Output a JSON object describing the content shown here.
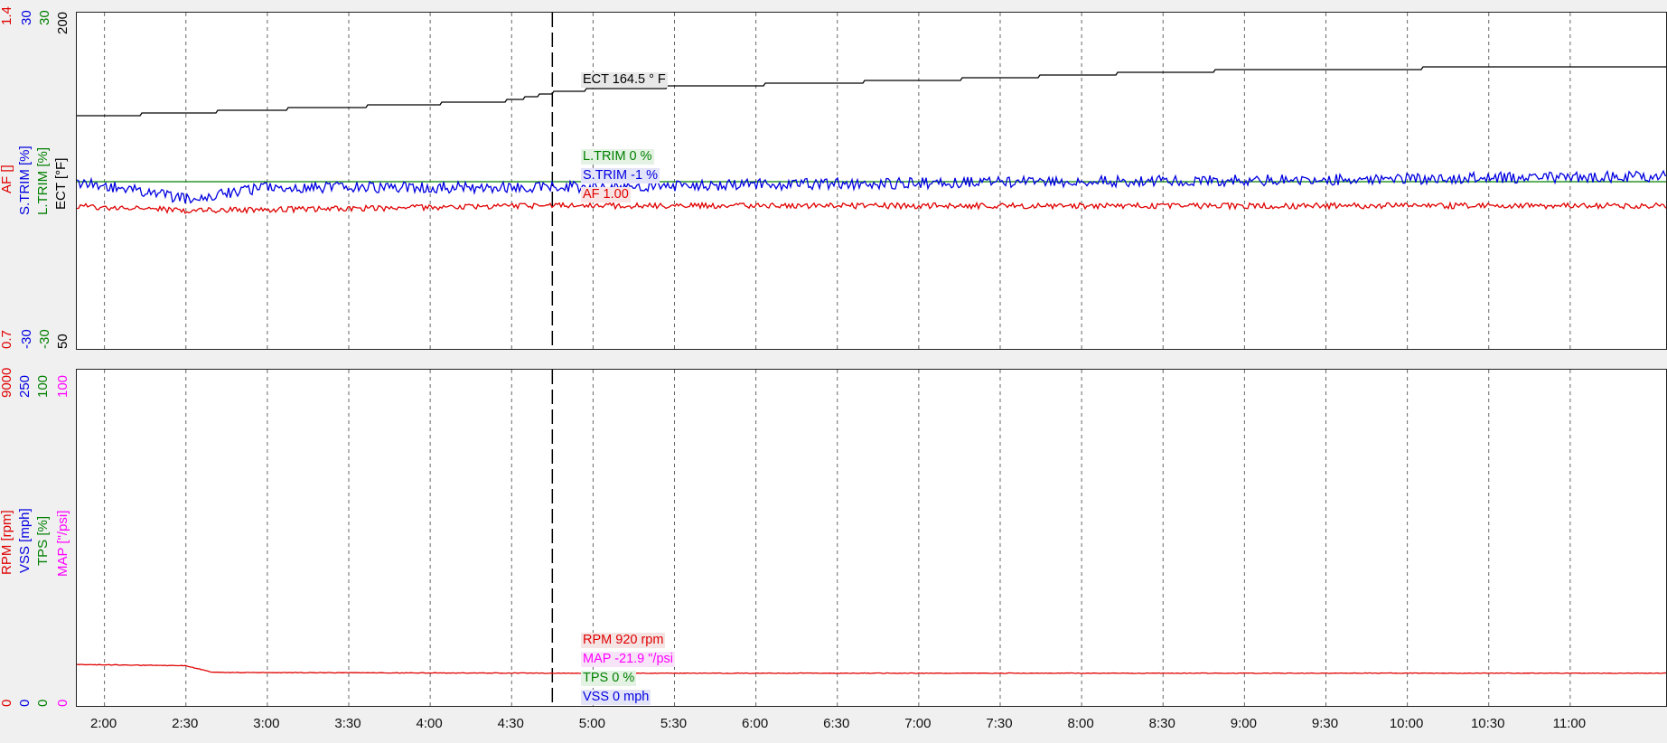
{
  "colors": {
    "af": "#e00000",
    "strim": "#0000e0",
    "ltrim": "#008000",
    "ect": "#000000",
    "map": "#ff00ff",
    "rpm": "#e00000",
    "vss": "#0000e0",
    "tps": "#008000"
  },
  "top_axis": {
    "af_max": "1.4",
    "af_min": "0.7",
    "strim_max": "30",
    "strim_min": "-30",
    "ect_max": "200",
    "ect_min": "50",
    "af_label": "AF []",
    "strim_label": "S.TRIM [%]",
    "ltrim_label": "L.TRIM [%]",
    "ect_label": "ECT [°F]"
  },
  "bottom_axis": {
    "rpm_max": "9000",
    "rpm_min": "0",
    "vss_max": "250",
    "vss_min": "0",
    "tps_max": "100",
    "tps_min": "0",
    "map_max": "100",
    "map_min": "0",
    "rpm_label": "RPM [rpm]",
    "vss_label": "VSS [mph]",
    "tps_label": "TPS [%]",
    "map_label": "MAP [\"/psi]"
  },
  "cursor": {
    "ect": "ECT 164.5 ° F",
    "ltrim": "L.TRIM 0 %",
    "strim": "S.TRIM -1 %",
    "af": "AF 1.00",
    "rpm": "RPM 920 rpm",
    "map": "MAP -21.9 \"/psi",
    "tps": "TPS 0 %",
    "vss": "VSS 0 mph"
  },
  "x_ticks": [
    "2:00",
    "2:30",
    "3:00",
    "3:30",
    "4:00",
    "4:30",
    "5:00",
    "5:30",
    "6:00",
    "6:30",
    "7:00",
    "7:30",
    "8:00",
    "8:30",
    "9:00",
    "9:30",
    "10:00",
    "10:30",
    "11:00"
  ],
  "chart_data": {
    "type": "line",
    "x_range_minutes": [
      1.83,
      11.6
    ],
    "cursor_time": "4:45",
    "top_series": [
      {
        "name": "ECT",
        "unit": "°F",
        "ylim": [
          50,
          200
        ],
        "x": [
          "1:50",
          "2:30",
          "3:00",
          "3:30",
          "4:00",
          "4:30",
          "4:45",
          "5:00",
          "5:30",
          "6:00",
          "6:30",
          "7:00",
          "7:30",
          "8:00",
          "8:30",
          "9:00",
          "9:30",
          "10:00",
          "10:30",
          "11:00",
          "11:35"
        ],
        "values": [
          154,
          155.5,
          157,
          158.2,
          159.5,
          161,
          164.5,
          166,
          167,
          168,
          169,
          170,
          171,
          172.5,
          173.5,
          174.5,
          175,
          175.3,
          175.5,
          175.8,
          176.3
        ]
      },
      {
        "name": "L.TRIM",
        "unit": "%",
        "ylim": [
          -30,
          30
        ],
        "x": [
          "1:50",
          "11:35"
        ],
        "values": [
          0,
          0
        ]
      },
      {
        "name": "S.TRIM",
        "unit": "%",
        "ylim": [
          -30,
          30
        ],
        "x": [
          "1:50",
          "2:30",
          "3:00",
          "4:00",
          "4:45",
          "6:00",
          "8:00",
          "10:00",
          "11:35"
        ],
        "values": [
          0,
          -3,
          -1,
          -1,
          -1,
          -0.5,
          0,
          0.5,
          1
        ]
      },
      {
        "name": "AF",
        "unit": "",
        "ylim": [
          0.7,
          1.4
        ],
        "x": [
          "1:50",
          "2:30",
          "4:45",
          "11:35"
        ],
        "values": [
          1.0,
          0.99,
          1.0,
          1.0
        ]
      }
    ],
    "bottom_series": [
      {
        "name": "RPM",
        "unit": "rpm",
        "ylim": [
          0,
          9000
        ],
        "x": [
          "1:50",
          "2:30",
          "2:40",
          "4:45",
          "11:35"
        ],
        "values": [
          1150,
          1120,
          940,
          920,
          920
        ]
      },
      {
        "name": "MAP",
        "unit": "\"/psi",
        "ylim": [
          0,
          100
        ],
        "x": [
          "1:50",
          "11:35"
        ],
        "values": [
          0,
          0
        ]
      },
      {
        "name": "TPS",
        "unit": "%",
        "ylim": [
          0,
          100
        ],
        "x": [
          "1:50",
          "11:35"
        ],
        "values": [
          0,
          0
        ]
      },
      {
        "name": "VSS",
        "unit": "mph",
        "ylim": [
          0,
          250
        ],
        "x": [
          "1:50",
          "11:35"
        ],
        "values": [
          0,
          0
        ]
      }
    ]
  }
}
